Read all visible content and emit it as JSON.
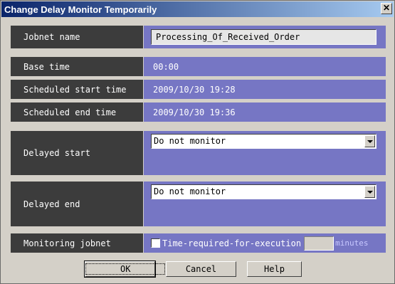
{
  "window": {
    "title": "Change Delay Monitor Temporarily",
    "close_glyph": "✕"
  },
  "fields": {
    "jobnet_name": {
      "label": "Jobnet name",
      "value": "Processing_Of_Received_Order"
    },
    "base_time": {
      "label": "Base time",
      "value": "00:00"
    },
    "scheduled_start": {
      "label": "Scheduled start time",
      "value": "2009/10/30 19:28"
    },
    "scheduled_end": {
      "label": "Scheduled end time",
      "value": "2009/10/30 19:36"
    },
    "delayed_start": {
      "label": "Delayed start",
      "selected": "Do not monitor"
    },
    "delayed_end": {
      "label": "Delayed end",
      "selected": "Do not monitor"
    },
    "monitoring_jobnet": {
      "label": "Monitoring jobnet",
      "checkbox_label": "Time-required-for-execution",
      "checked": false,
      "minutes_value": "",
      "unit": "minutes"
    }
  },
  "buttons": {
    "ok": "OK",
    "cancel": "Cancel",
    "help": "Help"
  }
}
